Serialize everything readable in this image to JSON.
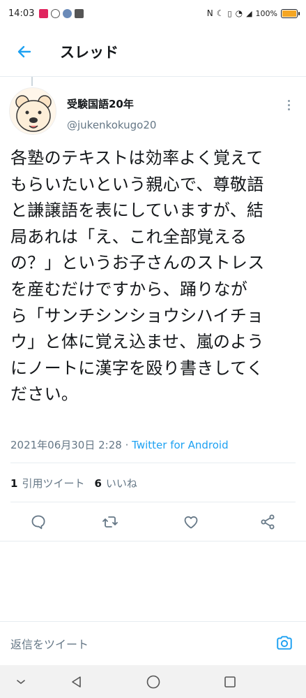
{
  "status_bar": {
    "time": "14:03",
    "battery": "100%"
  },
  "header": {
    "title": "スレッド"
  },
  "tweet": {
    "display_name": "受験国語20年",
    "handle": "@jukenkokugo20",
    "text": "各塾のテキストは効率よく覚えて\nもらいたいという親心で、尊敬語\nと謙譲語を表にしていますが、結\n局あれは「え、これ全部覚える\nの？」というお子さんのストレス\nを産むだけですから、踊りなが\nら「サンチシンショウシハイチョ\nウ」と体に覚え込ませ、嵐のよう\nにノートに漢字を殴り書きしてく\nださい。",
    "timestamp": "2021年06月30日 2:28",
    "separator": "·",
    "source": "Twitter for Android",
    "quote_count": "1",
    "quote_label": "引用ツイート",
    "like_count": "6",
    "like_label": "いいね"
  },
  "compose": {
    "placeholder": "返信をツイート"
  },
  "colors": {
    "accent": "#1da1f2",
    "text": "#14171a",
    "secondary": "#657786",
    "divider": "#e6ecf0"
  },
  "icons": {
    "back": "arrow-left-icon",
    "more": "more-vertical-icon",
    "reply": "reply-icon",
    "retweet": "retweet-icon",
    "like": "heart-icon",
    "share": "share-icon",
    "camera": "camera-icon"
  }
}
